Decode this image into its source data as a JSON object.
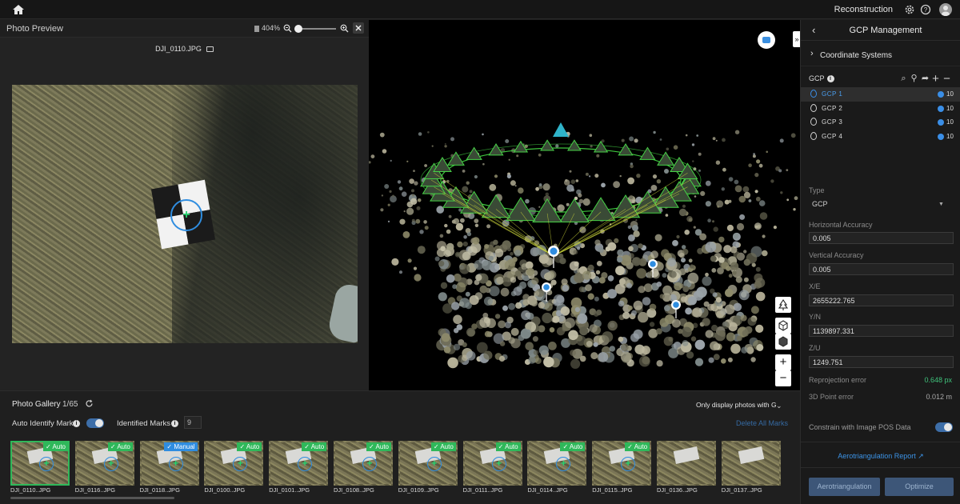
{
  "topbar": {
    "title": "Reconstruction",
    "icons": [
      "home-icon",
      "settings-icon",
      "help-icon",
      "user-icon"
    ]
  },
  "preview": {
    "title": "Photo Preview",
    "zoom_percent": "404%",
    "photo_name": "DJI_0110.JPG"
  },
  "viewport": {
    "gcp_markers": 4,
    "tools": [
      "camera-icon",
      "tree-icon",
      "cube-icon",
      "cube-solid-icon",
      "zoom-in-icon",
      "zoom-out-icon"
    ],
    "zoom_in_label": "+",
    "zoom_out_label": "−"
  },
  "gcp_panel": {
    "title": "GCP Management",
    "coordinate_systems": "Coordinate Systems",
    "gcp_header": "GCP",
    "gcps": [
      {
        "name": "GCP   1",
        "count": "10",
        "selected": true
      },
      {
        "name": "GCP   2",
        "count": "10",
        "selected": false
      },
      {
        "name": "GCP   3",
        "count": "10",
        "selected": false
      },
      {
        "name": "GCP   4",
        "count": "10",
        "selected": false
      }
    ],
    "type_label": "Type",
    "type_value": "GCP",
    "horizontal_accuracy_label": "Horizontal Accuracy",
    "horizontal_accuracy": "0.005",
    "vertical_accuracy_label": "Vertical Accuracy",
    "vertical_accuracy": "0.005",
    "x_label": "X/E",
    "x_value": "2655222.765",
    "y_label": "Y/N",
    "y_value": "1139897.331",
    "z_label": "Z/U",
    "z_value": "1249.751",
    "reprojection_label": "Reprojection error",
    "reprojection_value": "0.648 px",
    "point3d_label": "3D Point error",
    "point3d_value": "0.012 m",
    "constrain_label": "Constrain with Image POS Data",
    "constrain_on": true,
    "report_link": "Aerotriangulation Report",
    "aero_button": "Aerotriangulation",
    "optimize_button": "Optimize"
  },
  "gallery": {
    "title": "Photo Gallery",
    "count": "1/65",
    "filter": "Only display photos with G",
    "auto_identify_label": "Auto Identify Mark",
    "auto_identify_on": true,
    "identified_label": "Identified Marks",
    "identified_value": "9",
    "delete_all": "Delete All Marks",
    "thumbnails": [
      {
        "name": "DJI_0110..JPG",
        "badge": "Auto",
        "active": true
      },
      {
        "name": "DJI_0116..JPG",
        "badge": "Auto",
        "active": false
      },
      {
        "name": "DJI_0118..JPG",
        "badge": "Manual",
        "active": false
      },
      {
        "name": "DJI_0100..JPG",
        "badge": "Auto",
        "active": false
      },
      {
        "name": "DJI_0101..JPG",
        "badge": "Auto",
        "active": false
      },
      {
        "name": "DJI_0108..JPG",
        "badge": "Auto",
        "active": false
      },
      {
        "name": "DJI_0109..JPG",
        "badge": "Auto",
        "active": false
      },
      {
        "name": "DJI_0111..JPG",
        "badge": "Auto",
        "active": false
      },
      {
        "name": "DJI_0114..JPG",
        "badge": "Auto",
        "active": false
      },
      {
        "name": "DJI_0115..JPG",
        "badge": "Auto",
        "active": false
      },
      {
        "name": "DJI_0136..JPG",
        "badge": "",
        "active": false
      },
      {
        "name": "DJI_0137..JPG",
        "badge": "",
        "active": false
      }
    ]
  },
  "colors": {
    "accent_blue": "#2f8de0",
    "auto_green": "#2fb85a",
    "reprojection_green": "#3fc27b",
    "button_blue": "#3d5678"
  }
}
